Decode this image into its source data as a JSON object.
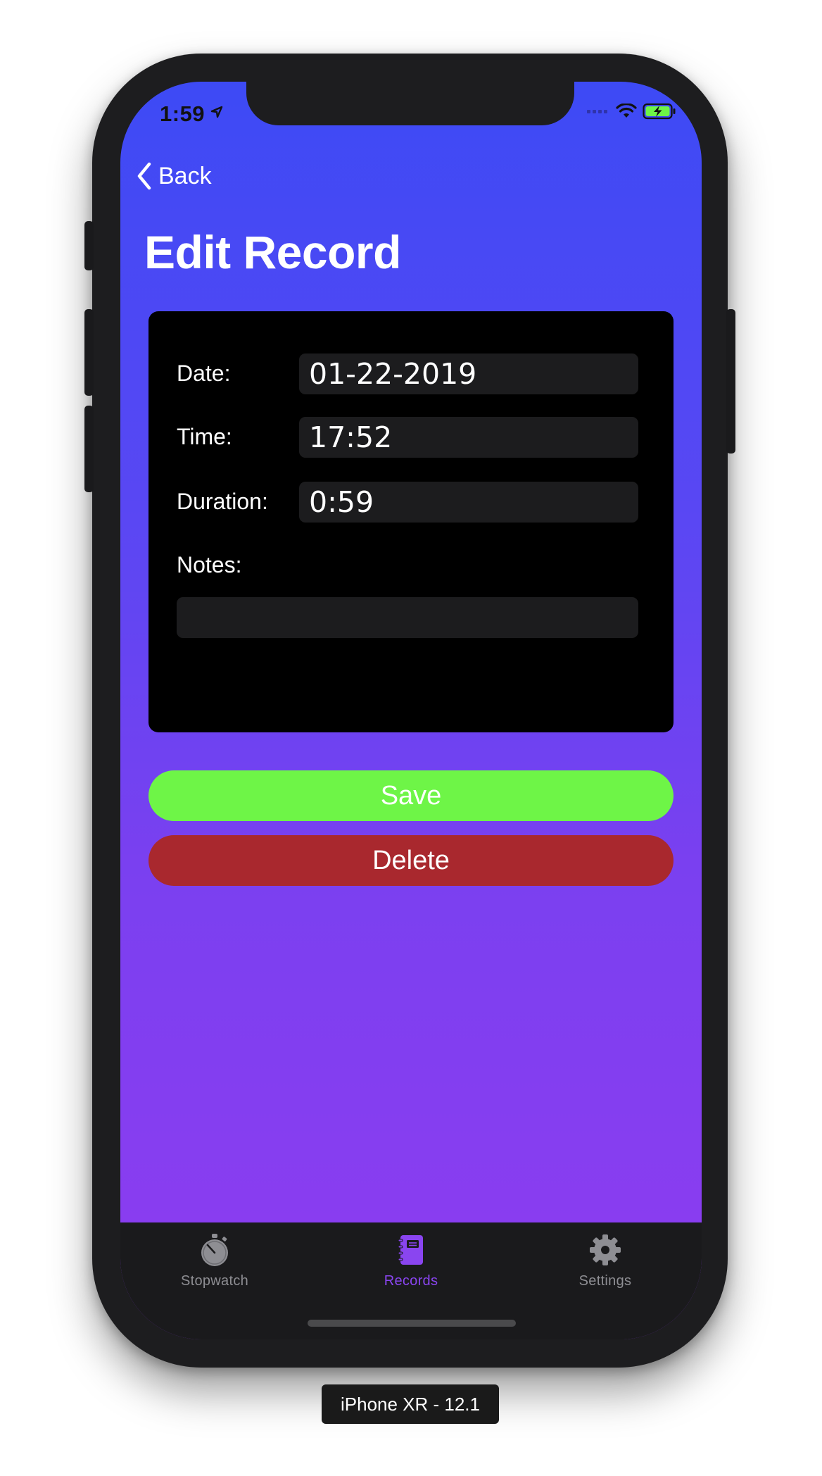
{
  "status_bar": {
    "time": "1:59"
  },
  "nav": {
    "back_label": "Back",
    "title": "Edit Record"
  },
  "form": {
    "date_label": "Date:",
    "date_value": "01-22-2019",
    "time_label": "Time:",
    "time_value": "17:52",
    "duration_label": "Duration:",
    "duration_value": "0:59",
    "notes_label": "Notes:",
    "notes_value": ""
  },
  "actions": {
    "save_label": "Save",
    "delete_label": "Delete"
  },
  "tab_bar": {
    "tabs": [
      {
        "label": "Stopwatch",
        "icon": "stopwatch-icon",
        "active": false
      },
      {
        "label": "Records",
        "icon": "notebook-icon",
        "active": true
      },
      {
        "label": "Settings",
        "icon": "gear-icon",
        "active": false
      }
    ]
  },
  "device_label": "iPhone XR - 12.1",
  "colors": {
    "gradient_top": "#3d4af5",
    "gradient_bottom": "#8e3cf0",
    "save": "#6ef547",
    "delete": "#a9282e",
    "tab_active": "#8a45f0",
    "tab_inactive": "#8e8e93"
  }
}
